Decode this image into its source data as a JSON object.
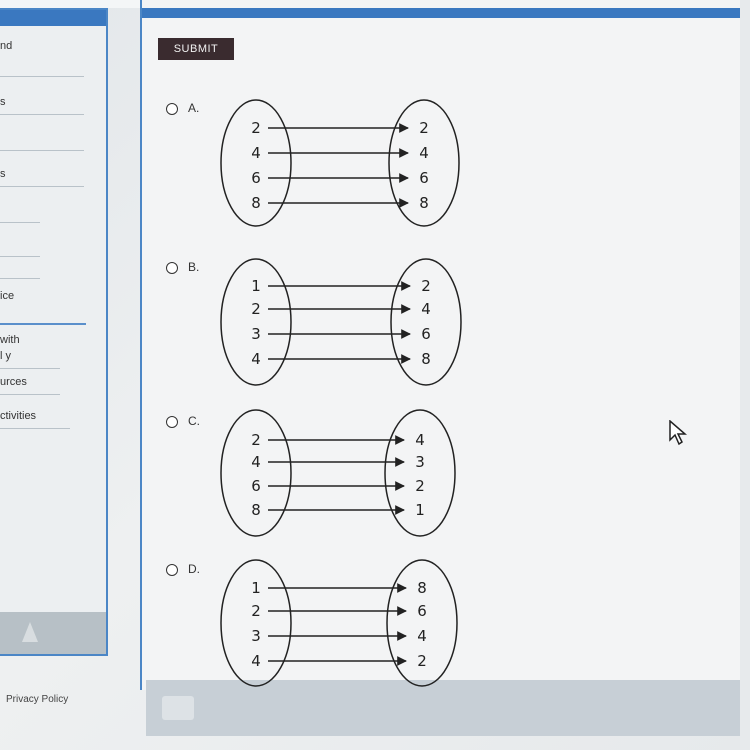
{
  "sidebar": {
    "items": [
      "nd",
      "s",
      "s",
      "ice",
      "with",
      "l y",
      "urces",
      "ctivities"
    ]
  },
  "main": {
    "submit_label": "SUBMIT"
  },
  "options": [
    {
      "label": "A.",
      "domain": [
        "2",
        "4",
        "6",
        "8"
      ],
      "range": [
        "2",
        "4",
        "6",
        "8"
      ]
    },
    {
      "label": "B.",
      "domain": [
        "1",
        "2",
        "3",
        "4"
      ],
      "range": [
        "2",
        "4",
        "6",
        "8"
      ]
    },
    {
      "label": "C.",
      "domain": [
        "2",
        "4",
        "6",
        "8"
      ],
      "range": [
        "4",
        "3",
        "2",
        "1"
      ]
    },
    {
      "label": "D.",
      "domain": [
        "1",
        "2",
        "3",
        "4"
      ],
      "range": [
        "8",
        "6",
        "4",
        "2"
      ]
    }
  ],
  "footer": {
    "privacy": "Privacy Policy"
  },
  "icons": {
    "cursor": "cursor-arrow-icon",
    "print": "printer-icon",
    "tree": "tree-icon"
  }
}
